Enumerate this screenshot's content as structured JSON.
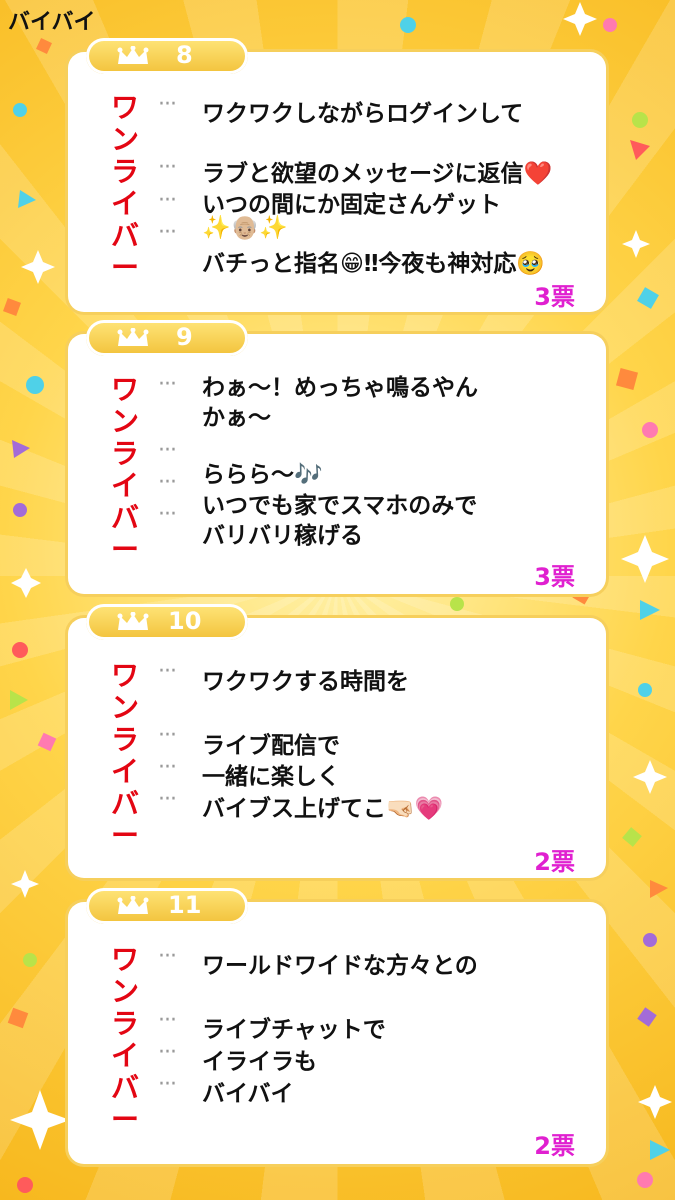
{
  "top_caption": "バイバイ",
  "vertical_label": [
    "ワ",
    "ン",
    "ラ",
    "イ",
    "バ",
    "ー"
  ],
  "entries": [
    {
      "rank": "8",
      "lines": [
        "ワクワクしながらログインして",
        "ラブと欲望のメッセージに返信❤️",
        "いつの間にか固定さんゲット",
        "✨👴🏼✨",
        "バチっと指名😁‼今夜も神対応🥹"
      ],
      "votes": "3票"
    },
    {
      "rank": "9",
      "lines": [
        "わぁ〜！めっちゃ鳴るやん",
        "かぁ〜",
        "ららら〜🎶",
        "いつでも家でスマホのみで",
        "バリバリ稼げる"
      ],
      "votes": "3票"
    },
    {
      "rank": "10",
      "lines": [
        "ワクワクする時間を",
        "ライブ配信で",
        "一緒に楽しく",
        "バイブス上げてこ🤜🏻💗"
      ],
      "votes": "2票"
    },
    {
      "rank": "11",
      "lines": [
        "ワールドワイドな方々との",
        "ライブチャットで",
        "イライラも",
        "バイバイ"
      ],
      "votes": "2票"
    }
  ],
  "colors": {
    "accent_red": "#e30613",
    "votes_magenta": "#e020d0",
    "badge_gold": "#f2c23a"
  }
}
